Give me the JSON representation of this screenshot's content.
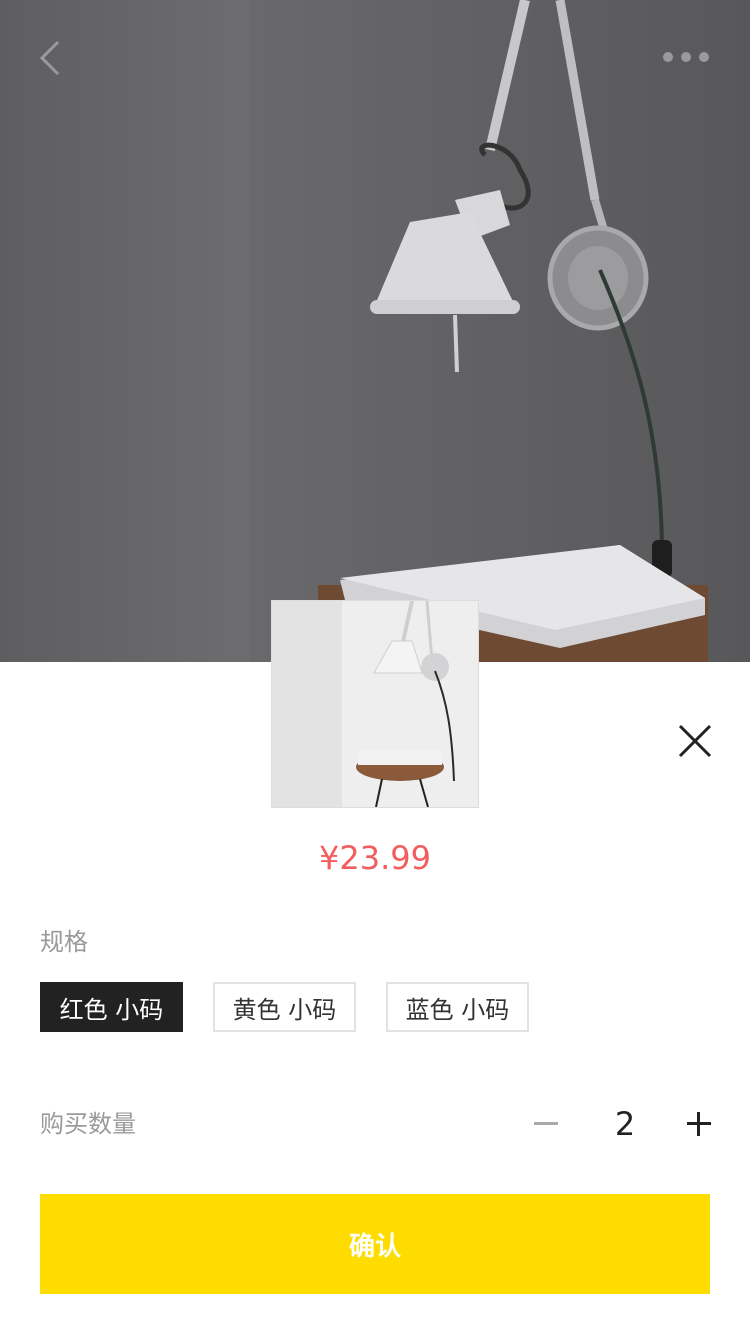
{
  "header": {
    "back_icon": "chevron-left-icon",
    "more_icon": "more-horizontal-icon"
  },
  "product": {
    "price": "¥23.99",
    "image_alt": "lamp-photo"
  },
  "sheet": {
    "close_icon": "close-icon",
    "spec_label": "规格",
    "spec_options": [
      "红色 小码",
      "黄色 小码",
      "蓝色 小码"
    ],
    "selected_spec_index": 0,
    "quantity_label": "购买数量",
    "quantity": "2",
    "confirm_label": "确认"
  },
  "colors": {
    "accent": "#ffdc00",
    "price": "#f25d5d",
    "selected_option": "#222222"
  }
}
